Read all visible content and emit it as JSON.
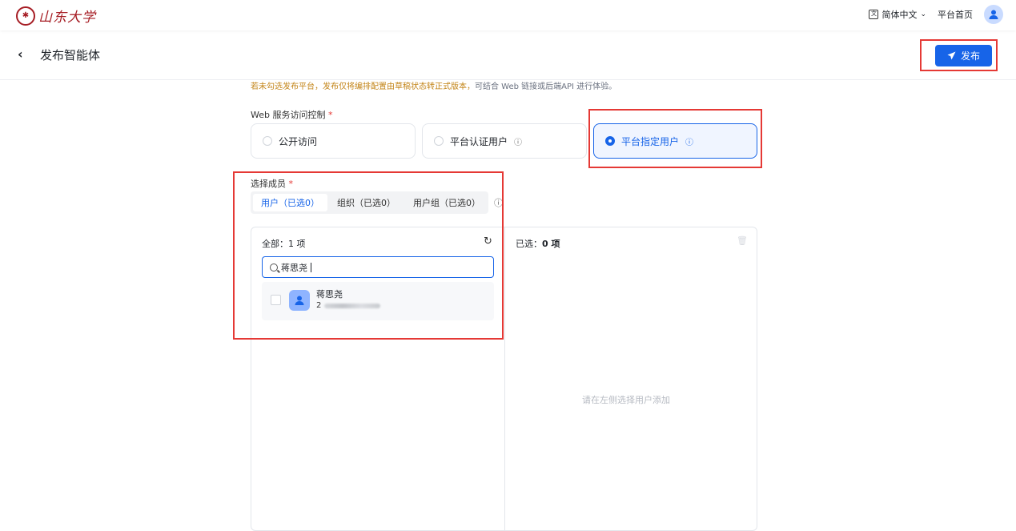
{
  "topbar": {
    "logo_text": "山东大学",
    "language": "简体中文",
    "home_link": "平台首页"
  },
  "header": {
    "back_icon": "chevron-left-icon",
    "title": "发布智能体",
    "publish_label": "发布"
  },
  "notice": {
    "highlight": "若未勾选发布平台，发布仅将编排配置由草稿状态转正式版本，",
    "rest": "可结合 Web 链接或后端API 进行体验。"
  },
  "access_control": {
    "label": "Web 服务访问控制",
    "required": "*",
    "options": [
      {
        "label": "公开访问",
        "selected": false,
        "info": false
      },
      {
        "label": "平台认证用户",
        "selected": false,
        "info": true
      },
      {
        "label": "平台指定用户",
        "selected": true,
        "info": true
      }
    ]
  },
  "members": {
    "label": "选择成员",
    "required": "*",
    "tabs": [
      "用户（已选0）",
      "组织（已选0）",
      "用户组（已选0）"
    ],
    "active_tab": 0
  },
  "transfer": {
    "left_header": "全部：1 项",
    "search_value": "蒋思尧",
    "users": [
      {
        "name": "蒋思尧",
        "id_prefix": "2"
      }
    ],
    "right_header_prefix": "已选：",
    "right_header_count": "0 项",
    "empty_text": "请在左侧选择用户添加"
  },
  "colors": {
    "primary": "#1764e8",
    "highlight_box": "#e53935",
    "notice": "#c38417"
  }
}
